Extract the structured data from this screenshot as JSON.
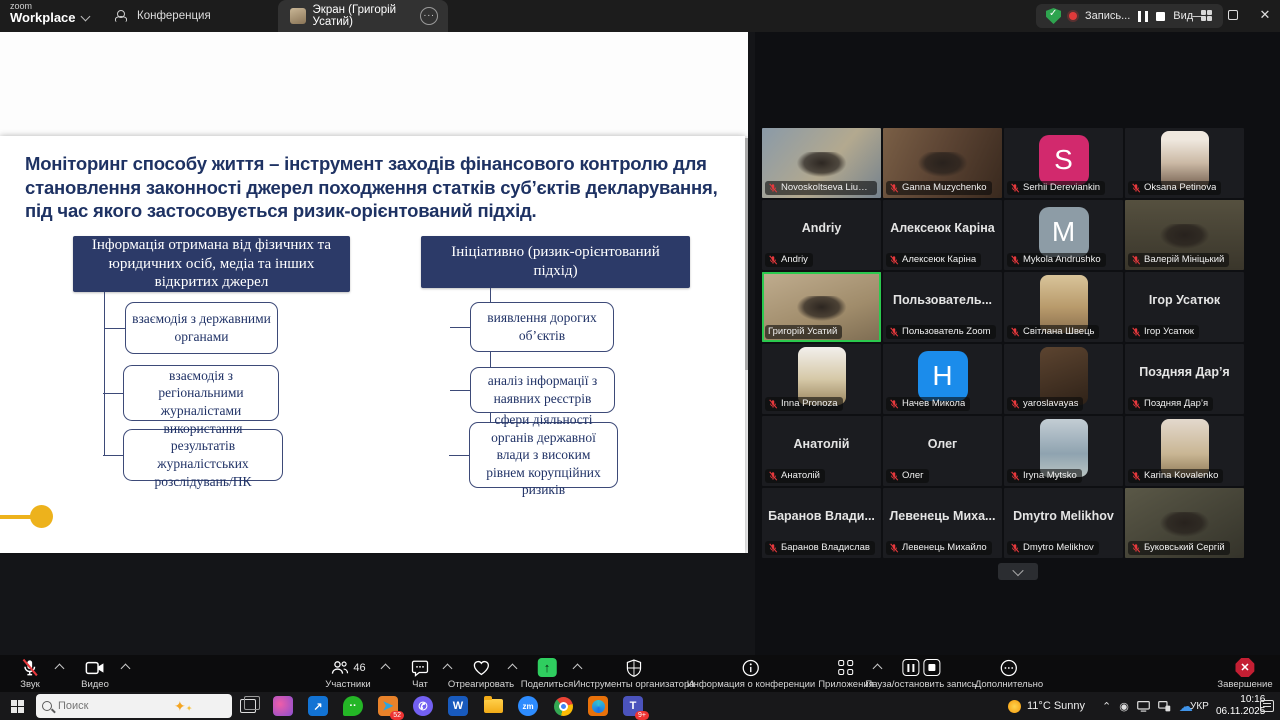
{
  "titlebar": {
    "logo_line1": "zoom",
    "logo_line2": "Workplace",
    "tab_conference": "Конференция",
    "tab_screen": "Экран (Григорій Усатий)",
    "recording_label": "Запись...",
    "view_label": "Вид"
  },
  "slide": {
    "title": "Моніторинг способу життя – інструмент заходів фінансового контролю для становлення законності джерел походження статків суб’єктів декларування, під час якого застосовується ризик-орієнтований підхід.",
    "left_header": "Інформація отримана від фізичних та юридичних осіб, медіа та інших відкритих джерел",
    "left_items": [
      "взаємодія з державними органами",
      "взаємодія з регіональними журналістами",
      "використання результатів журналістських розслідувань/ПК"
    ],
    "right_header": "Ініціативно (ризик-орієнтований підхід)",
    "right_items": [
      "виявлення дорогих об’єктів",
      "аналіз інформації з наявних реєстрів",
      "сфери діяльності органів державної влади з високим рівнем корупційних ризиків"
    ]
  },
  "participants": {
    "tiles": [
      {
        "label": "Novoskoltseva Liudmyla",
        "type": "video",
        "style": "t-v1",
        "muted": true
      },
      {
        "label": "Ganna Muzychenko",
        "type": "video",
        "style": "t-v2",
        "muted": true
      },
      {
        "label": "Serhii Dereviankin",
        "type": "letter",
        "letter": "S",
        "color": "#d2296d",
        "muted": true
      },
      {
        "label": "Oksana Petinova",
        "type": "photo",
        "style": "p-1",
        "muted": true
      },
      {
        "label": "Andriy",
        "center": "Andriy",
        "type": "name",
        "muted": true
      },
      {
        "label": "Алексеюк Каріна",
        "center": "Алексеюк Каріна",
        "type": "name",
        "muted": true
      },
      {
        "label": "Mykola Andrushko",
        "type": "letter",
        "letter": "M",
        "color": "#8d9ca6",
        "muted": true
      },
      {
        "label": "Валерій Мініцький",
        "type": "video",
        "style": "t-v3",
        "muted": true
      },
      {
        "label": "Григорій Усатий",
        "type": "video",
        "style": "t-v4",
        "muted": false,
        "active": true
      },
      {
        "label": "Пользователь Zoom",
        "center": "Пользователь...",
        "type": "name",
        "muted": true
      },
      {
        "label": "Світлана Швець",
        "type": "photo",
        "style": "p-2",
        "muted": true
      },
      {
        "label": "Ігор Усатюк",
        "center": "Ігор Усатюк",
        "type": "name",
        "muted": true
      },
      {
        "label": "Inna Pronoza",
        "type": "photo",
        "style": "p-3",
        "muted": true
      },
      {
        "label": "Начев Микола",
        "type": "letter",
        "letter": "H",
        "color": "#1b8ceb",
        "muted": true
      },
      {
        "label": "yaroslavayas",
        "type": "photo",
        "style": "p-4",
        "muted": true
      },
      {
        "label": "Поздняя Дар’я",
        "center": "Поздняя Дар’я",
        "type": "name",
        "muted": true
      },
      {
        "label": "Анатолій",
        "center": "Анатолій",
        "type": "name",
        "muted": true
      },
      {
        "label": "Олег",
        "center": "Олег",
        "type": "name",
        "muted": true
      },
      {
        "label": "Iryna Mytsko",
        "type": "photo",
        "style": "p-5",
        "muted": true
      },
      {
        "label": "Karina Kovalenko",
        "type": "photo",
        "style": "p-6",
        "muted": true
      },
      {
        "label": "Баранов Владислав",
        "center": "Баранов  Влади...",
        "type": "name",
        "muted": true
      },
      {
        "label": "Левенець Михайло",
        "center": "Левенець  Миха...",
        "type": "name",
        "muted": true
      },
      {
        "label": "Dmytro Melikhov",
        "center": "Dmytro Melikhov",
        "type": "name",
        "muted": true
      },
      {
        "label": "Буковський Сергій",
        "type": "video",
        "style": "t-v5",
        "muted": true
      }
    ]
  },
  "toolbar": {
    "audio": "Звук",
    "video": "Видео",
    "participants": "Участники",
    "participants_count": "46",
    "chat": "Чат",
    "react": "Отреагировать",
    "share": "Поделиться",
    "host_tools": "Инструменты организатора",
    "info": "Информация о конференции",
    "apps": "Приложения",
    "pause_stop": "Пауза/остановить запись",
    "more": "Дополнительно",
    "end": "Завершение"
  },
  "taskbar": {
    "search_placeholder": "Поиск",
    "weather": "11°C Sunny",
    "telegram_badge": "52",
    "teams_badge": "9+",
    "language": "УКР",
    "time": "10:16",
    "date": "06.11.2025"
  }
}
